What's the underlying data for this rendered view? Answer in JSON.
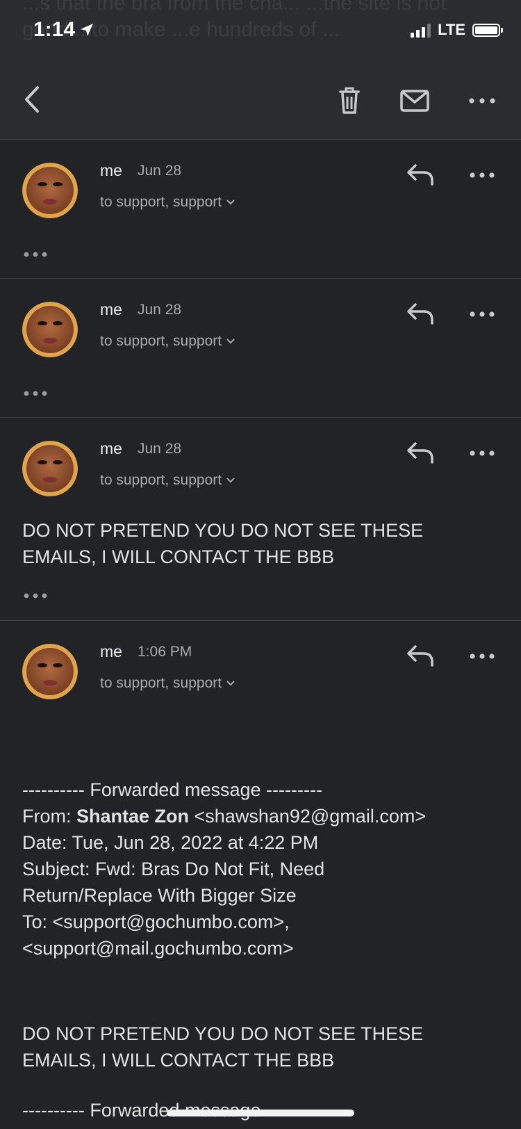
{
  "status_bar": {
    "time": "1:14",
    "network": "LTE"
  },
  "background_text": "...s that the bra from the cha... ...the site is not good ...to make ...e hundreds of ...",
  "toolbar": {
    "back_icon": "chevron-left-icon",
    "delete_icon": "trash-icon",
    "mail_icon": "envelope-icon",
    "more_icon": "more-horizontal-icon"
  },
  "messages": [
    {
      "sender": "me",
      "date": "Jun 28",
      "recipients": "to support, support",
      "body": ""
    },
    {
      "sender": "me",
      "date": "Jun 28",
      "recipients": "to support, support",
      "body": ""
    },
    {
      "sender": "me",
      "date": "Jun 28",
      "recipients": "to support, support",
      "body": "DO NOT PRETEND YOU DO NOT SEE THESE EMAILS, I WILL CONTACT THE BBB"
    },
    {
      "sender": "me",
      "date": "1:06 PM",
      "recipients": "to support, support",
      "forward_header": "---------- Forwarded message ---------",
      "from_label": "From: ",
      "from_name": "Shantae Zon",
      "from_email": " <shawshan92@gmail.com>",
      "date_line": "Date: Tue, Jun 28, 2022 at 4:22 PM",
      "subject_line_1": "Subject: Fwd: Bras Do Not Fit, Need",
      "subject_line_2": "Return/Replace With Bigger Size",
      "to_line_1": "To: <support@gochumbo.com>,",
      "to_line_2": "<support@mail.gochumbo.com>",
      "body": "DO NOT PRETEND YOU DO NOT SEE THESE EMAILS, I WILL CONTACT THE BBB",
      "forward_header_2": "---------- Forwarded message ---------"
    }
  ]
}
